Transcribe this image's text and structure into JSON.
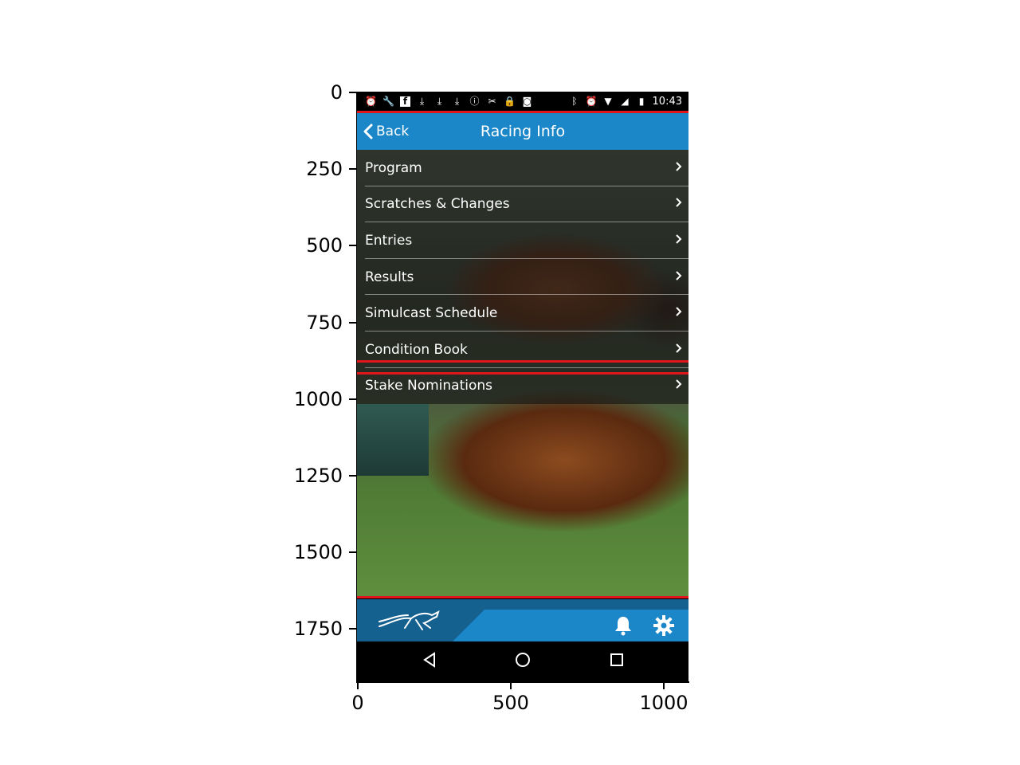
{
  "axes": {
    "y_ticks": [
      "0",
      "250",
      "500",
      "750",
      "1000",
      "1250",
      "1500",
      "1750"
    ],
    "x_ticks": [
      "0",
      "500",
      "1000"
    ]
  },
  "status_bar": {
    "time": "10:43",
    "left_icons": [
      "alarm-icon",
      "wrench-icon",
      "facebook-icon",
      "download-icon",
      "download-icon",
      "download-icon",
      "info-icon",
      "tools-icon",
      "lock-icon",
      "android-icon"
    ],
    "right_icons": [
      "bluetooth-icon",
      "alarm-icon",
      "wifi-icon",
      "signal-icon",
      "battery-icon"
    ]
  },
  "app_bar": {
    "back_label": "Back",
    "title": "Racing Info",
    "color": "#1b87c9"
  },
  "menu": {
    "items": [
      {
        "label": "Program"
      },
      {
        "label": "Scratches & Changes"
      },
      {
        "label": "Entries"
      },
      {
        "label": "Results"
      },
      {
        "label": "Simulcast Schedule"
      },
      {
        "label": "Condition Book"
      },
      {
        "label": "Stake Nominations"
      }
    ]
  },
  "bottom_bar": {
    "logo": "horse-logo-icon",
    "icons": [
      "bell-icon",
      "gear-icon"
    ],
    "color": "#14618f"
  },
  "nav_bar": {
    "buttons": [
      "back-triangle-icon",
      "home-circle-icon",
      "recents-square-icon"
    ]
  },
  "highlight_color": "#e0161c"
}
